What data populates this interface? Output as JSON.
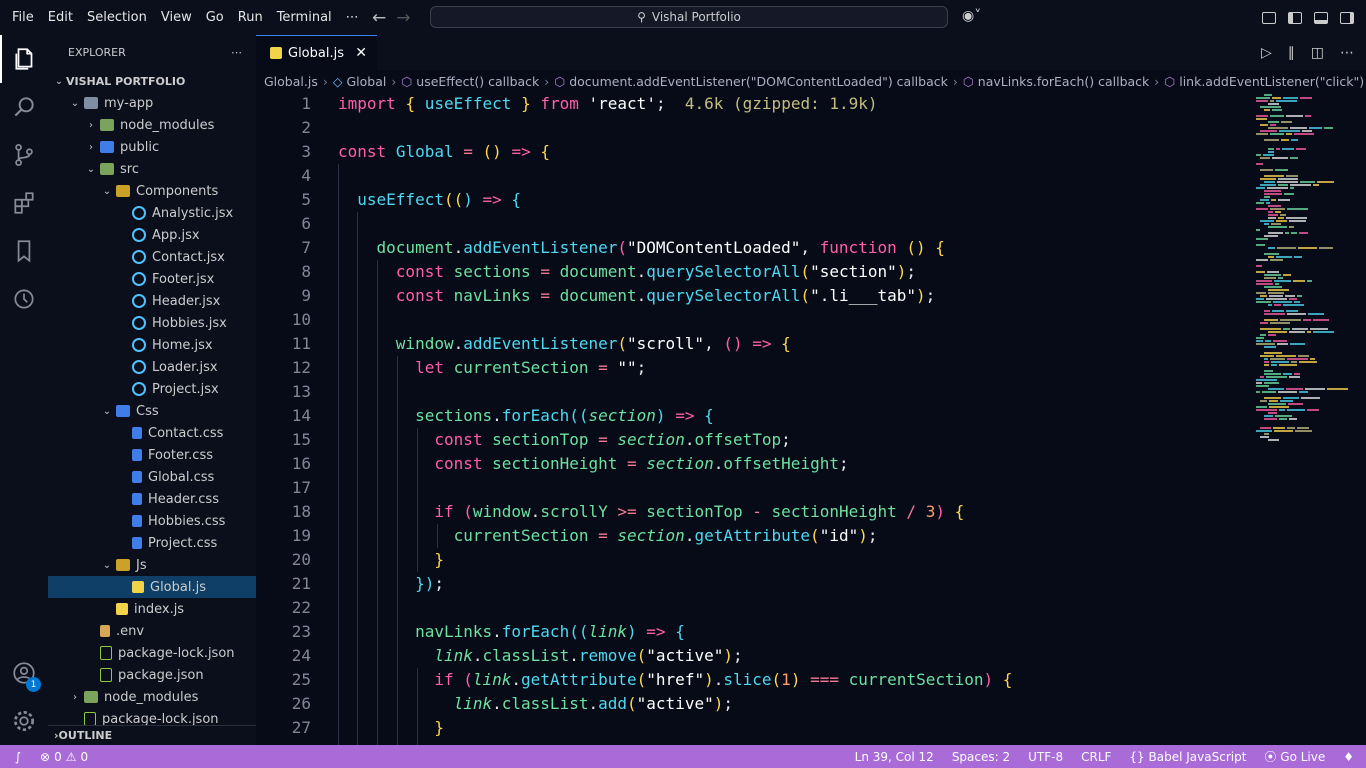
{
  "menu": [
    "File",
    "Edit",
    "Selection",
    "View",
    "Go",
    "Run",
    "Terminal",
    "⋯"
  ],
  "search": {
    "text": "Vishal Portfolio"
  },
  "explorer": {
    "header": "EXPLORER",
    "more": "⋯",
    "root": "VISHAL PORTFOLIO",
    "items": [
      {
        "label": "my-app",
        "depth": 1,
        "chev": "⌄",
        "icon": "folder"
      },
      {
        "label": "node_modules",
        "depth": 2,
        "chev": "›",
        "icon": "folder-green"
      },
      {
        "label": "public",
        "depth": 2,
        "chev": "›",
        "icon": "folder-blue"
      },
      {
        "label": "src",
        "depth": 2,
        "chev": "⌄",
        "icon": "folder-green"
      },
      {
        "label": "Components",
        "depth": 3,
        "chev": "⌄",
        "icon": "folder-yellow"
      },
      {
        "label": "Analystic.jsx",
        "depth": 4,
        "chev": "",
        "icon": "jsx"
      },
      {
        "label": "App.jsx",
        "depth": 4,
        "chev": "",
        "icon": "jsx"
      },
      {
        "label": "Contact.jsx",
        "depth": 4,
        "chev": "",
        "icon": "jsx"
      },
      {
        "label": "Footer.jsx",
        "depth": 4,
        "chev": "",
        "icon": "jsx"
      },
      {
        "label": "Header.jsx",
        "depth": 4,
        "chev": "",
        "icon": "jsx"
      },
      {
        "label": "Hobbies.jsx",
        "depth": 4,
        "chev": "",
        "icon": "jsx"
      },
      {
        "label": "Home.jsx",
        "depth": 4,
        "chev": "",
        "icon": "jsx"
      },
      {
        "label": "Loader.jsx",
        "depth": 4,
        "chev": "",
        "icon": "jsx"
      },
      {
        "label": "Project.jsx",
        "depth": 4,
        "chev": "",
        "icon": "jsx"
      },
      {
        "label": "Css",
        "depth": 3,
        "chev": "⌄",
        "icon": "folder-blue"
      },
      {
        "label": "Contact.css",
        "depth": 4,
        "chev": "",
        "icon": "css"
      },
      {
        "label": "Footer.css",
        "depth": 4,
        "chev": "",
        "icon": "css"
      },
      {
        "label": "Global.css",
        "depth": 4,
        "chev": "",
        "icon": "css"
      },
      {
        "label": "Header.css",
        "depth": 4,
        "chev": "",
        "icon": "css"
      },
      {
        "label": "Hobbies.css",
        "depth": 4,
        "chev": "",
        "icon": "css"
      },
      {
        "label": "Project.css",
        "depth": 4,
        "chev": "",
        "icon": "css"
      },
      {
        "label": "Js",
        "depth": 3,
        "chev": "⌄",
        "icon": "folder-yellow"
      },
      {
        "label": "Global.js",
        "depth": 4,
        "chev": "",
        "icon": "js",
        "selected": true
      },
      {
        "label": "index.js",
        "depth": 3,
        "chev": "",
        "icon": "js"
      },
      {
        "label": ".env",
        "depth": 2,
        "chev": "",
        "icon": "env"
      },
      {
        "label": "package-lock.json",
        "depth": 2,
        "chev": "",
        "icon": "json"
      },
      {
        "label": "package.json",
        "depth": 2,
        "chev": "",
        "icon": "json"
      },
      {
        "label": "node_modules",
        "depth": 1,
        "chev": "›",
        "icon": "folder-green"
      },
      {
        "label": "package-lock.json",
        "depth": 1,
        "chev": "",
        "icon": "json"
      }
    ],
    "outline": "OUTLINE"
  },
  "activity": {
    "account_badge": "1"
  },
  "tab": {
    "label": "Global.js",
    "close": "✕"
  },
  "breadcrumbs": [
    "Global.js",
    "Global",
    "useEffect() callback",
    "document.addEventListener(\"DOMContentLoaded\") callback",
    "navLinks.forEach() callback",
    "link.addEventListener(\"click\") callback"
  ],
  "code": [
    {
      "n": "1",
      "t": [
        [
          "k",
          "import"
        ],
        [
          "w",
          " "
        ],
        [
          "p",
          "{"
        ],
        [
          "w",
          " "
        ],
        [
          "f",
          "useEffect"
        ],
        [
          "w",
          " "
        ],
        [
          "p",
          "}"
        ],
        [
          "w",
          " "
        ],
        [
          "k",
          "from"
        ],
        [
          "w",
          " "
        ],
        [
          "s",
          "'react'"
        ],
        [
          "w",
          ";  "
        ],
        [
          "c",
          "4.6k (gzipped: 1.9k)"
        ]
      ]
    },
    {
      "n": "2",
      "t": []
    },
    {
      "n": "3",
      "t": [
        [
          "k",
          "const"
        ],
        [
          "w",
          " "
        ],
        [
          "f",
          "Global"
        ],
        [
          "w",
          " "
        ],
        [
          "o",
          "="
        ],
        [
          "w",
          " "
        ],
        [
          "p",
          "()"
        ],
        [
          "w",
          " "
        ],
        [
          "k",
          "=>"
        ],
        [
          "w",
          " "
        ],
        [
          "p",
          "{"
        ]
      ]
    },
    {
      "n": "4",
      "t": []
    },
    {
      "n": "5",
      "t": [
        [
          "w",
          "  "
        ],
        [
          "f",
          "useEffect"
        ],
        [
          "p",
          "(("
        ],
        [
          "f",
          ")"
        ],
        [
          "w",
          " "
        ],
        [
          "k",
          "=>"
        ],
        [
          "w",
          " "
        ],
        [
          "f",
          "{"
        ]
      ]
    },
    {
      "n": "6",
      "t": []
    },
    {
      "n": "7",
      "t": [
        [
          "w",
          "    "
        ],
        [
          "v",
          "document"
        ],
        [
          "w",
          "."
        ],
        [
          "f",
          "addEventListener"
        ],
        [
          "k",
          "("
        ],
        [
          "s",
          "\"DOMContentLoaded\""
        ],
        [
          "w",
          ", "
        ],
        [
          "k",
          "function"
        ],
        [
          "w",
          " "
        ],
        [
          "p",
          "()"
        ],
        [
          "w",
          " "
        ],
        [
          "p",
          "{"
        ]
      ]
    },
    {
      "n": "8",
      "t": [
        [
          "w",
          "      "
        ],
        [
          "k",
          "const"
        ],
        [
          "w",
          " "
        ],
        [
          "v",
          "sections"
        ],
        [
          "w",
          " "
        ],
        [
          "o",
          "="
        ],
        [
          "w",
          " "
        ],
        [
          "v",
          "document"
        ],
        [
          "w",
          "."
        ],
        [
          "f",
          "querySelectorAll"
        ],
        [
          "p",
          "("
        ],
        [
          "s",
          "\"section\""
        ],
        [
          "p",
          ")"
        ],
        [
          "w",
          ";"
        ]
      ]
    },
    {
      "n": "9",
      "t": [
        [
          "w",
          "      "
        ],
        [
          "k",
          "const"
        ],
        [
          "w",
          " "
        ],
        [
          "v",
          "navLinks"
        ],
        [
          "w",
          " "
        ],
        [
          "o",
          "="
        ],
        [
          "w",
          " "
        ],
        [
          "v",
          "document"
        ],
        [
          "w",
          "."
        ],
        [
          "f",
          "querySelectorAll"
        ],
        [
          "p",
          "("
        ],
        [
          "s",
          "\".li___tab\""
        ],
        [
          "p",
          ")"
        ],
        [
          "w",
          ";"
        ]
      ]
    },
    {
      "n": "10",
      "t": []
    },
    {
      "n": "11",
      "t": [
        [
          "w",
          "      "
        ],
        [
          "v",
          "window"
        ],
        [
          "w",
          "."
        ],
        [
          "f",
          "addEventListener"
        ],
        [
          "p",
          "("
        ],
        [
          "s",
          "\"scroll\""
        ],
        [
          "w",
          ", "
        ],
        [
          "k",
          "()"
        ],
        [
          "w",
          " "
        ],
        [
          "k",
          "=>"
        ],
        [
          "w",
          " "
        ],
        [
          "p",
          "{"
        ]
      ]
    },
    {
      "n": "12",
      "t": [
        [
          "w",
          "        "
        ],
        [
          "k",
          "let"
        ],
        [
          "w",
          " "
        ],
        [
          "v",
          "currentSection"
        ],
        [
          "w",
          " "
        ],
        [
          "o",
          "="
        ],
        [
          "w",
          " "
        ],
        [
          "s",
          "\"\""
        ],
        [
          "w",
          ";"
        ]
      ]
    },
    {
      "n": "13",
      "t": []
    },
    {
      "n": "14",
      "t": [
        [
          "w",
          "        "
        ],
        [
          "v",
          "sections"
        ],
        [
          "w",
          "."
        ],
        [
          "f",
          "forEach"
        ],
        [
          "f",
          "(("
        ],
        [
          "i",
          "section"
        ],
        [
          "f",
          ")"
        ],
        [
          "w",
          " "
        ],
        [
          "k",
          "=>"
        ],
        [
          "w",
          " "
        ],
        [
          "f",
          "{"
        ]
      ]
    },
    {
      "n": "15",
      "t": [
        [
          "w",
          "          "
        ],
        [
          "k",
          "const"
        ],
        [
          "w",
          " "
        ],
        [
          "v",
          "sectionTop"
        ],
        [
          "w",
          " "
        ],
        [
          "o",
          "="
        ],
        [
          "w",
          " "
        ],
        [
          "i",
          "section"
        ],
        [
          "w",
          "."
        ],
        [
          "v",
          "offsetTop"
        ],
        [
          "w",
          ";"
        ]
      ]
    },
    {
      "n": "16",
      "t": [
        [
          "w",
          "          "
        ],
        [
          "k",
          "const"
        ],
        [
          "w",
          " "
        ],
        [
          "v",
          "sectionHeight"
        ],
        [
          "w",
          " "
        ],
        [
          "o",
          "="
        ],
        [
          "w",
          " "
        ],
        [
          "i",
          "section"
        ],
        [
          "w",
          "."
        ],
        [
          "v",
          "offsetHeight"
        ],
        [
          "w",
          ";"
        ]
      ]
    },
    {
      "n": "17",
      "t": []
    },
    {
      "n": "18",
      "t": [
        [
          "w",
          "          "
        ],
        [
          "k",
          "if"
        ],
        [
          "w",
          " "
        ],
        [
          "k",
          "("
        ],
        [
          "v",
          "window"
        ],
        [
          "w",
          "."
        ],
        [
          "v",
          "scrollY"
        ],
        [
          "w",
          " "
        ],
        [
          "o",
          ">="
        ],
        [
          "w",
          " "
        ],
        [
          "v",
          "sectionTop"
        ],
        [
          "w",
          " "
        ],
        [
          "o",
          "-"
        ],
        [
          "w",
          " "
        ],
        [
          "v",
          "sectionHeight"
        ],
        [
          "w",
          " "
        ],
        [
          "o",
          "/"
        ],
        [
          "w",
          " "
        ],
        [
          "n",
          "3"
        ],
        [
          "k",
          ")"
        ],
        [
          "w",
          " "
        ],
        [
          "p",
          "{"
        ]
      ]
    },
    {
      "n": "19",
      "t": [
        [
          "w",
          "            "
        ],
        [
          "v",
          "currentSection"
        ],
        [
          "w",
          " "
        ],
        [
          "o",
          "="
        ],
        [
          "w",
          " "
        ],
        [
          "i",
          "section"
        ],
        [
          "w",
          "."
        ],
        [
          "f",
          "getAttribute"
        ],
        [
          "p",
          "("
        ],
        [
          "s",
          "\"id\""
        ],
        [
          "p",
          ")"
        ],
        [
          "w",
          ";"
        ]
      ]
    },
    {
      "n": "20",
      "t": [
        [
          "w",
          "          "
        ],
        [
          "p",
          "}"
        ]
      ]
    },
    {
      "n": "21",
      "t": [
        [
          "w",
          "        "
        ],
        [
          "f",
          "})"
        ],
        [
          "w",
          ";"
        ]
      ]
    },
    {
      "n": "22",
      "t": []
    },
    {
      "n": "23",
      "t": [
        [
          "w",
          "        "
        ],
        [
          "v",
          "navLinks"
        ],
        [
          "w",
          "."
        ],
        [
          "f",
          "forEach"
        ],
        [
          "f",
          "(("
        ],
        [
          "i",
          "link"
        ],
        [
          "f",
          ")"
        ],
        [
          "w",
          " "
        ],
        [
          "k",
          "=>"
        ],
        [
          "w",
          " "
        ],
        [
          "f",
          "{"
        ]
      ]
    },
    {
      "n": "24",
      "t": [
        [
          "w",
          "          "
        ],
        [
          "i",
          "link"
        ],
        [
          "w",
          "."
        ],
        [
          "v",
          "classList"
        ],
        [
          "w",
          "."
        ],
        [
          "f",
          "remove"
        ],
        [
          "p",
          "("
        ],
        [
          "s",
          "\"active\""
        ],
        [
          "p",
          ")"
        ],
        [
          "w",
          ";"
        ]
      ]
    },
    {
      "n": "25",
      "t": [
        [
          "w",
          "          "
        ],
        [
          "k",
          "if"
        ],
        [
          "w",
          " "
        ],
        [
          "k",
          "("
        ],
        [
          "i",
          "link"
        ],
        [
          "w",
          "."
        ],
        [
          "f",
          "getAttribute"
        ],
        [
          "p",
          "("
        ],
        [
          "s",
          "\"href\""
        ],
        [
          "p",
          ")"
        ],
        [
          "w",
          "."
        ],
        [
          "f",
          "slice"
        ],
        [
          "p",
          "("
        ],
        [
          "n",
          "1"
        ],
        [
          "p",
          ")"
        ],
        [
          "w",
          " "
        ],
        [
          "o",
          "==="
        ],
        [
          "w",
          " "
        ],
        [
          "v",
          "currentSection"
        ],
        [
          "k",
          ")"
        ],
        [
          "w",
          " "
        ],
        [
          "p",
          "{"
        ]
      ]
    },
    {
      "n": "26",
      "t": [
        [
          "w",
          "            "
        ],
        [
          "i",
          "link"
        ],
        [
          "w",
          "."
        ],
        [
          "v",
          "classList"
        ],
        [
          "w",
          "."
        ],
        [
          "f",
          "add"
        ],
        [
          "p",
          "("
        ],
        [
          "s",
          "\"active\""
        ],
        [
          "p",
          ")"
        ],
        [
          "w",
          ";"
        ]
      ]
    },
    {
      "n": "27",
      "t": [
        [
          "w",
          "          "
        ],
        [
          "p",
          "}"
        ]
      ]
    },
    {
      "n": "",
      "t": [
        [
          "w",
          "        "
        ],
        [
          "f",
          "});"
        ]
      ]
    }
  ],
  "status": {
    "errors": "0",
    "warnings": "0",
    "position": "Ln 39, Col 12",
    "spaces": "Spaces: 2",
    "encoding": "UTF-8",
    "eol": "CRLF",
    "language": "Babel JavaScript",
    "golive": "Go Live"
  }
}
